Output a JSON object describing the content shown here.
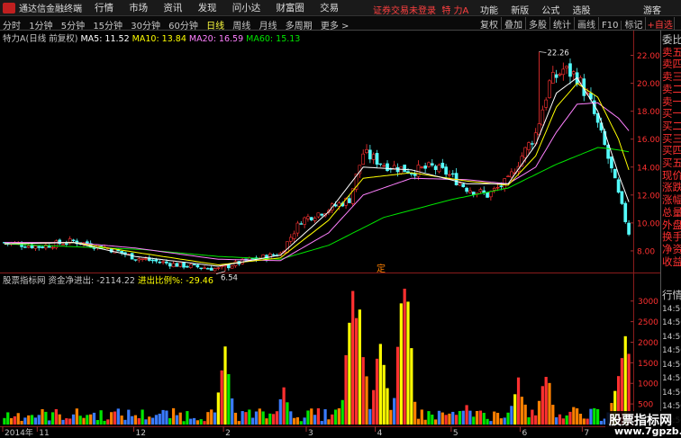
{
  "titlebar": {
    "app_name": "通达信金融终端",
    "menu": [
      "行情",
      "市场",
      "资讯",
      "发现",
      "问小达",
      "财富圈",
      "交易"
    ],
    "warning": "证券交易未登录",
    "stock_name": "特 力A",
    "right_menu": [
      "功能",
      "新版",
      "公式",
      "选股"
    ],
    "guest": "游客"
  },
  "toolbar": {
    "periods": [
      "分时",
      "1分钟",
      "5分钟",
      "15分钟",
      "30分钟",
      "60分钟",
      "日线",
      "周线",
      "月线",
      "多周期",
      "更多 >"
    ],
    "active_period": "日线",
    "tools": [
      "复权",
      "叠加",
      "多股",
      "统计",
      "画线",
      "F10",
      "标记",
      "+自选"
    ]
  },
  "kline_legend": {
    "stock": "特力A(日线 前复权)",
    "ma5": "MA5: 11.52",
    "ma10": "MA10: 13.84",
    "ma20": "MA20: 16.59",
    "ma60": "MA60: 15.13"
  },
  "vol_legend": {
    "name": "股票指标网 资金净进出: -2114.22",
    "ratio": "进出比例%: -29.46"
  },
  "annotations": {
    "high_label": "22.26",
    "low_label": "6.54",
    "marker": "定"
  },
  "right_panel": {
    "labels": [
      "委比",
      "卖五",
      "卖四",
      "卖三",
      "卖二",
      "卖一",
      "买一",
      "买二",
      "买三",
      "买四",
      "买五",
      "现价",
      "涨跌",
      "涨幅",
      "总量",
      "外盘",
      "换手",
      "净资",
      "收益"
    ],
    "lower": [
      "行情",
      "14:50",
      "14:50",
      "14:50",
      "14:50",
      "14:50",
      "14:50",
      "14:50",
      "14:50",
      "14:50"
    ]
  },
  "watermark": {
    "line1": "股票指标网",
    "line2": "www.7gpzb.com"
  },
  "colors": {
    "up": "#ff3232",
    "down": "#54fcfc",
    "ma5": "#ffffff",
    "ma10": "#ffff00",
    "ma20": "#ff80ff",
    "ma60": "#00e600",
    "vol_yellow": "#ffff00",
    "vol_red": "#ff3030",
    "vol_orange": "#ff8000",
    "vol_green": "#00e600",
    "vol_blue": "#3a7bff"
  },
  "chart_data": {
    "type": "candlestick",
    "price_axis": {
      "ticks": [
        22.0,
        20.0,
        18.0,
        16.0,
        14.0,
        12.0,
        10.0,
        8.0
      ],
      "ylim": [
        6.0,
        23.0
      ]
    },
    "volume_axis": {
      "ticks": [
        3000,
        2500,
        2000,
        1500,
        1000,
        500
      ],
      "ylim": [
        0,
        3300
      ]
    },
    "x_ticks": [
      "2014年",
      "11",
      "12",
      "2",
      "3",
      "4",
      "5",
      "6",
      "7"
    ],
    "x_tick_pos": [
      0,
      10,
      38,
      64,
      88,
      108,
      130,
      150,
      168
    ],
    "n_bars": 182,
    "close_path": [
      [
        0,
        8.6
      ],
      [
        10,
        8.3
      ],
      [
        20,
        8.7
      ],
      [
        30,
        8.2
      ],
      [
        38,
        7.5
      ],
      [
        50,
        7.0
      ],
      [
        62,
        6.7
      ],
      [
        70,
        7.3
      ],
      [
        80,
        7.8
      ],
      [
        86,
        10.2
      ],
      [
        94,
        11.0
      ],
      [
        100,
        11.7
      ],
      [
        104,
        15.0
      ],
      [
        110,
        14.2
      ],
      [
        118,
        13.7
      ],
      [
        124,
        14.0
      ],
      [
        128,
        13.6
      ],
      [
        134,
        12.5
      ],
      [
        140,
        12.0
      ],
      [
        146,
        13.0
      ],
      [
        150,
        14.8
      ],
      [
        154,
        16.4
      ],
      [
        158,
        20.0
      ],
      [
        162,
        21.0
      ],
      [
        166,
        20.5
      ],
      [
        170,
        18.5
      ],
      [
        174,
        15.5
      ],
      [
        178,
        12.0
      ],
      [
        181,
        9.3
      ]
    ],
    "ma5_path": [
      [
        0,
        8.5
      ],
      [
        20,
        8.6
      ],
      [
        38,
        7.6
      ],
      [
        62,
        6.9
      ],
      [
        80,
        7.7
      ],
      [
        94,
        10.8
      ],
      [
        104,
        14.0
      ],
      [
        118,
        13.8
      ],
      [
        134,
        12.8
      ],
      [
        146,
        12.8
      ],
      [
        154,
        15.6
      ],
      [
        160,
        19.3
      ],
      [
        166,
        20.4
      ],
      [
        172,
        18.0
      ],
      [
        178,
        13.5
      ],
      [
        181,
        11.5
      ]
    ],
    "ma10_path": [
      [
        0,
        8.5
      ],
      [
        20,
        8.6
      ],
      [
        38,
        7.9
      ],
      [
        62,
        7.0
      ],
      [
        80,
        7.5
      ],
      [
        94,
        10.2
      ],
      [
        104,
        13.2
      ],
      [
        118,
        13.6
      ],
      [
        134,
        13.0
      ],
      [
        146,
        12.7
      ],
      [
        154,
        14.8
      ],
      [
        160,
        18.3
      ],
      [
        166,
        20.0
      ],
      [
        172,
        19.0
      ],
      [
        178,
        16.0
      ],
      [
        181,
        13.8
      ]
    ],
    "ma20_path": [
      [
        0,
        8.6
      ],
      [
        20,
        8.6
      ],
      [
        38,
        8.2
      ],
      [
        62,
        7.4
      ],
      [
        80,
        7.3
      ],
      [
        94,
        9.3
      ],
      [
        104,
        12.0
      ],
      [
        118,
        13.2
      ],
      [
        134,
        13.1
      ],
      [
        146,
        12.8
      ],
      [
        154,
        14.0
      ],
      [
        160,
        16.5
      ],
      [
        166,
        18.5
      ],
      [
        172,
        18.6
      ],
      [
        178,
        17.5
      ],
      [
        181,
        16.6
      ]
    ],
    "ma60_path": [
      [
        0,
        8.5
      ],
      [
        40,
        8.1
      ],
      [
        62,
        7.6
      ],
      [
        80,
        7.4
      ],
      [
        94,
        8.4
      ],
      [
        110,
        10.4
      ],
      [
        130,
        11.7
      ],
      [
        146,
        12.5
      ],
      [
        160,
        14.2
      ],
      [
        172,
        15.4
      ],
      [
        176,
        15.3
      ],
      [
        181,
        15.1
      ]
    ],
    "high": {
      "bar": 155,
      "value": 22.26
    },
    "low": {
      "bar": 64,
      "value": 6.54
    },
    "volume_peaks": [
      [
        64,
        1900
      ],
      [
        81,
        950
      ],
      [
        101,
        2900
      ],
      [
        103,
        2050
      ],
      [
        109,
        1800
      ],
      [
        116,
        3200
      ],
      [
        134,
        500
      ],
      [
        149,
        1150
      ],
      [
        157,
        1450
      ],
      [
        165,
        550
      ],
      [
        176,
        400
      ],
      [
        178,
        1150
      ],
      [
        180,
        2000
      ]
    ]
  }
}
